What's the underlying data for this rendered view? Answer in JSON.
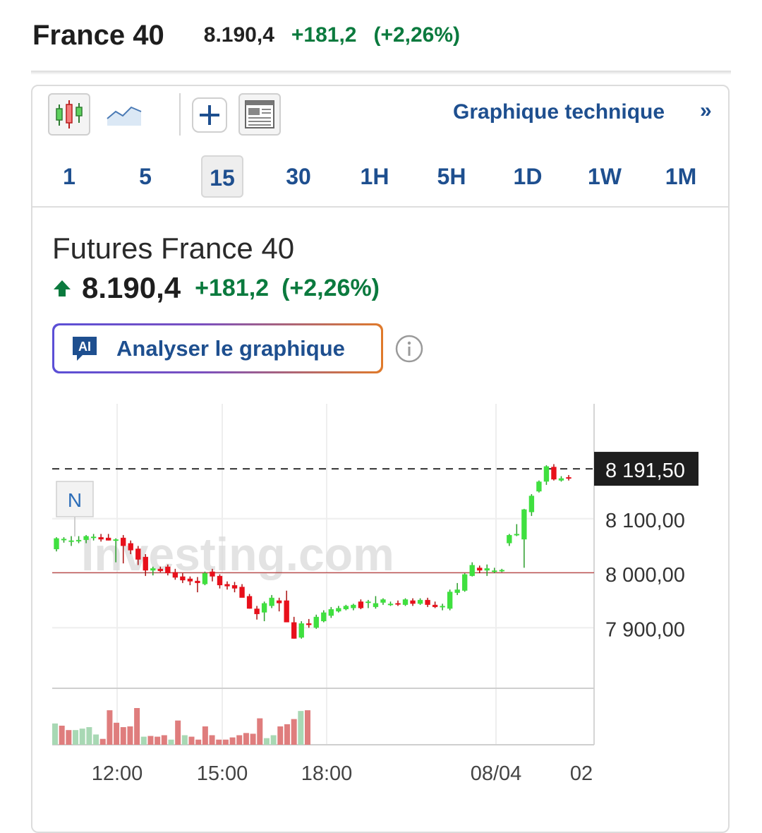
{
  "header": {
    "name": "France 40",
    "price": "8.190,4",
    "change": "+181,2",
    "change_pct": "(+2,26%)"
  },
  "toolbar": {
    "icons": [
      "candlestick-chart-icon",
      "area-chart-icon",
      "add-indicator-icon",
      "news-layout-icon"
    ],
    "technical_link": "Graphique technique",
    "technical_arrow": "»"
  },
  "timeframes": [
    "1",
    "5",
    "15",
    "30",
    "1H",
    "5H",
    "1D",
    "1W",
    "1M"
  ],
  "selected_timeframe": "15",
  "instrument": {
    "title": "Futures France 40",
    "price": "8.190,4",
    "change": "+181,2",
    "change_pct": "(+2,26%)"
  },
  "ai_button": {
    "badge": "AI",
    "label": "Analyser le graphique"
  },
  "colors": {
    "up": "#3fe03f",
    "down": "#e8101b",
    "accent": "#1e4f8f",
    "positive_text": "#0b7a3e"
  },
  "chart_data": {
    "type": "candlestick",
    "interval": "15",
    "y_ticks": [
      "8 100,00",
      "8 000,00",
      "7 900,00"
    ],
    "y_tick_values": [
      8100,
      8000,
      7900
    ],
    "x_ticks": [
      "12:00",
      "15:00",
      "18:00",
      "08/04",
      "02"
    ],
    "last_price_label": "8 191,50",
    "last_price": 8191.5,
    "reference_line": 8001,
    "watermark": "Investing.com",
    "event_marker": "N",
    "candles": [
      [
        8044,
        8066,
        8040,
        8064
      ],
      [
        8062,
        8066,
        8056,
        8063
      ],
      [
        8058,
        8068,
        8050,
        8060
      ],
      [
        8060,
        8068,
        8055,
        8061
      ],
      [
        8061,
        8070,
        8055,
        8068
      ],
      [
        8066,
        8072,
        8060,
        8067
      ],
      [
        8066,
        8072,
        8058,
        8062
      ],
      [
        8065,
        8072,
        8060,
        8060
      ],
      [
        8060,
        8064,
        8020,
        8062
      ],
      [
        8065,
        8070,
        8018,
        8050
      ],
      [
        8055,
        8060,
        8035,
        8042
      ],
      [
        8045,
        8050,
        8015,
        8025
      ],
      [
        8030,
        8035,
        7995,
        8005
      ],
      [
        8005,
        8012,
        7996,
        8009
      ],
      [
        8008,
        8012,
        8002,
        8004
      ],
      [
        8012,
        8016,
        7996,
        8000
      ],
      [
        8002,
        8008,
        7988,
        7992
      ],
      [
        7994,
        8000,
        7982,
        7987
      ],
      [
        7990,
        7994,
        7978,
        7985
      ],
      [
        7986,
        7993,
        7965,
        7982
      ],
      [
        7980,
        8003,
        7978,
        8000
      ],
      [
        8003,
        8008,
        7985,
        7994
      ],
      [
        7995,
        7998,
        7972,
        7978
      ],
      [
        7980,
        7985,
        7970,
        7976
      ],
      [
        7978,
        7984,
        7965,
        7972
      ],
      [
        7975,
        7980,
        7960,
        7955
      ],
      [
        7958,
        7962,
        7935,
        7935
      ],
      [
        7935,
        7940,
        7915,
        7925
      ],
      [
        7928,
        7948,
        7912,
        7945
      ],
      [
        7940,
        7960,
        7936,
        7955
      ],
      [
        7950,
        7955,
        7930,
        7945
      ],
      [
        7950,
        7968,
        7910,
        7910
      ],
      [
        7910,
        7920,
        7880,
        7880
      ],
      [
        7882,
        7912,
        7880,
        7908
      ],
      [
        7908,
        7916,
        7900,
        7905
      ],
      [
        7900,
        7924,
        7898,
        7920
      ],
      [
        7912,
        7932,
        7910,
        7928
      ],
      [
        7922,
        7938,
        7918,
        7934
      ],
      [
        7930,
        7940,
        7928,
        7936
      ],
      [
        7934,
        7942,
        7932,
        7940
      ],
      [
        7936,
        7944,
        7932,
        7942
      ],
      [
        7948,
        7952,
        7934,
        7936
      ],
      [
        7946,
        7951,
        7936,
        7948
      ],
      [
        7938,
        7958,
        7935,
        7945
      ],
      [
        7946,
        7954,
        7942,
        7952
      ],
      [
        7944,
        7948,
        7940,
        7944
      ],
      [
        7945,
        7950,
        7940,
        7944
      ],
      [
        7942,
        7954,
        7940,
        7952
      ],
      [
        7950,
        7954,
        7940,
        7944
      ],
      [
        7944,
        7954,
        7942,
        7951
      ],
      [
        7951,
        7955,
        7938,
        7942
      ],
      [
        7942,
        7948,
        7936,
        7938
      ],
      [
        7938,
        7944,
        7932,
        7940
      ],
      [
        7935,
        7970,
        7932,
        7966
      ],
      [
        7964,
        7982,
        7960,
        7970
      ],
      [
        7968,
        8000,
        7966,
        7998
      ],
      [
        7995,
        8020,
        7994,
        8015
      ],
      [
        8010,
        8014,
        8000,
        8005
      ],
      [
        8005,
        8016,
        7995,
        8009
      ],
      [
        8005,
        8010,
        8000,
        8005
      ],
      [
        8005,
        8008,
        8002,
        8006
      ],
      [
        8055,
        8072,
        8050,
        8070
      ],
      [
        8070,
        8090,
        8068,
        8072
      ],
      [
        8062,
        8118,
        8010,
        8117
      ],
      [
        8112,
        8145,
        8105,
        8142
      ],
      [
        8150,
        8170,
        8148,
        8168
      ],
      [
        8168,
        8198,
        8162,
        8196
      ],
      [
        8195,
        8200,
        8170,
        8172
      ],
      [
        8170,
        8178,
        8168,
        8174
      ],
      [
        8176,
        8180,
        8170,
        8174
      ]
    ],
    "volume": [
      [
        "up",
        0.58
      ],
      [
        "down",
        0.52
      ],
      [
        "down",
        0.4
      ],
      [
        "up",
        0.4
      ],
      [
        "up",
        0.44
      ],
      [
        "up",
        0.48
      ],
      [
        "up",
        0.28
      ],
      [
        "down",
        0.16
      ],
      [
        "down",
        0.94
      ],
      [
        "down",
        0.6
      ],
      [
        "down",
        0.48
      ],
      [
        "down",
        0.5
      ],
      [
        "down",
        1.0
      ],
      [
        "up",
        0.22
      ],
      [
        "down",
        0.24
      ],
      [
        "down",
        0.22
      ],
      [
        "down",
        0.26
      ],
      [
        "up",
        0.14
      ],
      [
        "down",
        0.66
      ],
      [
        "up",
        0.26
      ],
      [
        "down",
        0.22
      ],
      [
        "down",
        0.14
      ],
      [
        "down",
        0.5
      ],
      [
        "down",
        0.26
      ],
      [
        "down",
        0.14
      ],
      [
        "down",
        0.14
      ],
      [
        "down",
        0.2
      ],
      [
        "down",
        0.26
      ],
      [
        "down",
        0.32
      ],
      [
        "down",
        0.3
      ],
      [
        "down",
        0.72
      ],
      [
        "up",
        0.18
      ],
      [
        "up",
        0.26
      ],
      [
        "down",
        0.5
      ],
      [
        "down",
        0.56
      ],
      [
        "down",
        0.7
      ],
      [
        "up",
        0.92
      ],
      [
        "down",
        0.94
      ]
    ]
  }
}
